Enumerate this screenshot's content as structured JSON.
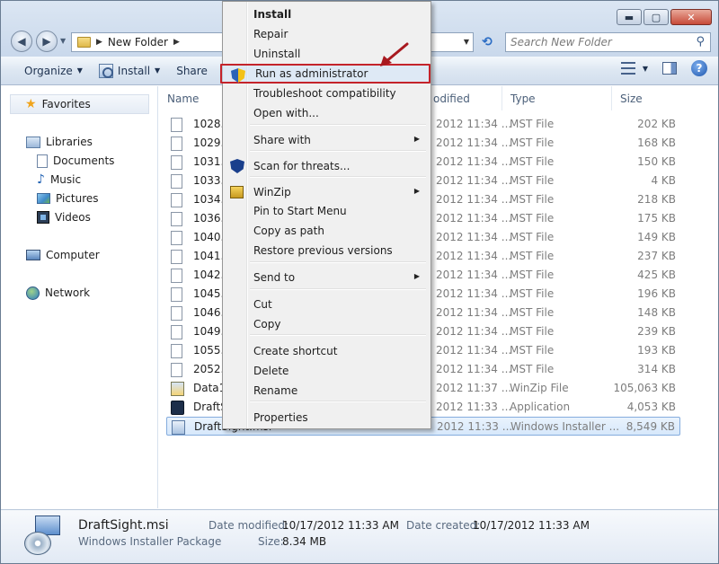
{
  "window": {
    "buttons": {
      "minimize": "▬",
      "maximize": "▢",
      "close": "✕"
    }
  },
  "address": {
    "path": "New Folder",
    "search_placeholder": "Search New Folder"
  },
  "toolbar": {
    "organize": "Organize",
    "install": "Install",
    "share": "Share"
  },
  "navpane": {
    "favorites": "Favorites",
    "libraries": "Libraries",
    "documents": "Documents",
    "music": "Music",
    "pictures": "Pictures",
    "videos": "Videos",
    "computer": "Computer",
    "network": "Network"
  },
  "columns": {
    "name": "Name",
    "modified": "odified",
    "type": "Type",
    "size": "Size"
  },
  "files": [
    {
      "name": "1028.m",
      "date": "2012 11:34 ...",
      "type": "MST File",
      "size": "202 KB",
      "icon": "doc-icon"
    },
    {
      "name": "1029.m",
      "date": "2012 11:34 ...",
      "type": "MST File",
      "size": "168 KB",
      "icon": "doc-icon"
    },
    {
      "name": "1031.m",
      "date": "2012 11:34 ...",
      "type": "MST File",
      "size": "150 KB",
      "icon": "doc-icon"
    },
    {
      "name": "1033.m",
      "date": "2012 11:34 ...",
      "type": "MST File",
      "size": "4 KB",
      "icon": "doc-icon"
    },
    {
      "name": "1034.m",
      "date": "2012 11:34 ...",
      "type": "MST File",
      "size": "218 KB",
      "icon": "doc-icon"
    },
    {
      "name": "1036.m",
      "date": "2012 11:34 ...",
      "type": "MST File",
      "size": "175 KB",
      "icon": "doc-icon"
    },
    {
      "name": "1040.m",
      "date": "2012 11:34 ...",
      "type": "MST File",
      "size": "149 KB",
      "icon": "doc-icon"
    },
    {
      "name": "1041.m",
      "date": "2012 11:34 ...",
      "type": "MST File",
      "size": "237 KB",
      "icon": "doc-icon"
    },
    {
      "name": "1042.m",
      "date": "2012 11:34 ...",
      "type": "MST File",
      "size": "425 KB",
      "icon": "doc-icon"
    },
    {
      "name": "1045.m",
      "date": "2012 11:34 ...",
      "type": "MST File",
      "size": "196 KB",
      "icon": "doc-icon"
    },
    {
      "name": "1046.m",
      "date": "2012 11:34 ...",
      "type": "MST File",
      "size": "148 KB",
      "icon": "doc-icon"
    },
    {
      "name": "1049.m",
      "date": "2012 11:34 ...",
      "type": "MST File",
      "size": "239 KB",
      "icon": "doc-icon"
    },
    {
      "name": "1055.m",
      "date": "2012 11:34 ...",
      "type": "MST File",
      "size": "193 KB",
      "icon": "doc-icon"
    },
    {
      "name": "2052.m",
      "date": "2012 11:34 ...",
      "type": "MST File",
      "size": "314 KB",
      "icon": "doc-icon"
    },
    {
      "name": "Data1.c",
      "date": "2012 11:37 ...",
      "type": "WinZip File",
      "size": "105,063 KB",
      "icon": "winzip-icon"
    },
    {
      "name": "DraftSig",
      "date": "2012 11:33 ...",
      "type": "Application",
      "size": "4,053 KB",
      "icon": "app-icon"
    },
    {
      "name": "DraftSight.msi",
      "date": "2012 11:33 ...",
      "type": "Windows Installer ...",
      "size": "8,549 KB",
      "icon": "msi-icon",
      "selected": true
    }
  ],
  "context_menu": {
    "items": [
      {
        "label": "Install",
        "bold": true
      },
      {
        "label": "Repair"
      },
      {
        "label": "Uninstall"
      },
      {
        "label": "Run as administrator",
        "icon": "uac-shield-icon",
        "highlighted": true
      },
      {
        "label": "Troubleshoot compatibility"
      },
      {
        "label": "Open with..."
      },
      {
        "label": "Share with",
        "submenu": true
      },
      {
        "label": "Scan for threats...",
        "icon": "antivirus-shield-icon"
      },
      {
        "label": "WinZip",
        "icon": "winzip-icon",
        "submenu": true
      },
      {
        "label": "Pin to Start Menu"
      },
      {
        "label": "Copy as path"
      },
      {
        "label": "Restore previous versions"
      },
      {
        "label": "Send to",
        "submenu": true
      },
      {
        "label": "Cut"
      },
      {
        "label": "Copy"
      },
      {
        "label": "Create shortcut"
      },
      {
        "label": "Delete"
      },
      {
        "label": "Rename"
      },
      {
        "label": "Properties"
      }
    ]
  },
  "details": {
    "filename": "DraftSight.msi",
    "filetype": "Windows Installer Package",
    "modified_label": "Date modified:",
    "modified_value": "10/17/2012 11:33 AM",
    "created_label": "Date created:",
    "created_value": "10/17/2012 11:33 AM",
    "size_label": "Size:",
    "size_value": "8.34 MB"
  },
  "colors": {
    "highlight_border": "#c4232a",
    "annotation_arrow": "#a8191f",
    "selection": "#d7e8fb"
  }
}
